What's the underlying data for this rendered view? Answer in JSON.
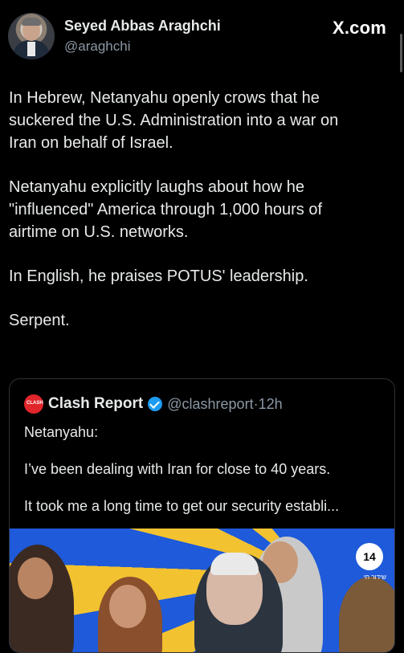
{
  "header": {
    "display_name": "Seyed Abbas Araghchi",
    "handle": "@araghchi",
    "site": "X.com"
  },
  "tweet": {
    "paragraphs": [
      "In Hebrew, Netanyahu openly crows that he\nsuckered the U.S. Administration into a war on\nIran on behalf of Israel.",
      "Netanyahu explicitly laughs about how he\n\"influenced\" America through 1,000 hours of\nairtime on U.S. networks.",
      "In English, he praises POTUS' leadership.",
      "Serpent."
    ]
  },
  "quoted_tweet": {
    "avatar_label": "CLASH",
    "name": "Clash Report",
    "handle": "@clashreport",
    "separator": "·",
    "time": "12h",
    "lines": [
      "Netanyahu:",
      "I’ve been dealing with Iran for close to 40 years.",
      "It took me a long time to get our security establi..."
    ],
    "media": {
      "channel_logo": "14",
      "live_label": "שידור חי"
    }
  },
  "colors": {
    "background": "#000000",
    "text": "#e7e9ea",
    "secondary": "#8b98a5",
    "verified": "#1d9bf0",
    "border": "#2f3336"
  },
  "icons": {
    "verified": "verified-badge-icon",
    "avatar": "profile-photo"
  }
}
